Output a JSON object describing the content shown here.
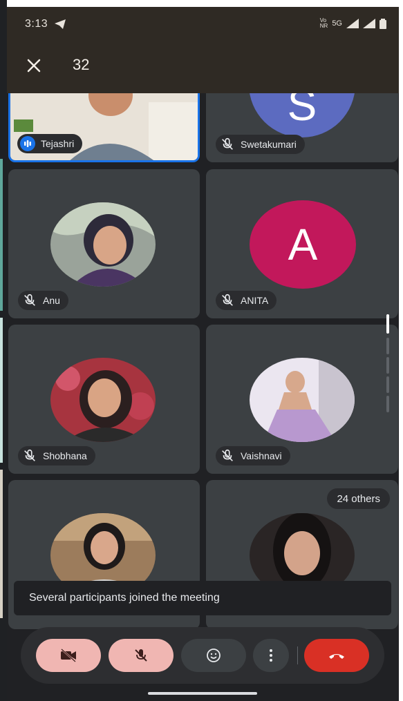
{
  "status_bar": {
    "time": "3:13",
    "network": "5G"
  },
  "header": {
    "participant_count": "32"
  },
  "participants": [
    {
      "name": "Tejashri",
      "speaking": true
    },
    {
      "name": "Swetakumari",
      "avatar_letter": "S",
      "avatar_color": "#5c6bc0"
    },
    {
      "name": "Anu"
    },
    {
      "name": "ANITA",
      "avatar_letter": "A",
      "avatar_color": "#c2185b"
    },
    {
      "name": "Shobhana"
    },
    {
      "name": "Vaishnavi"
    }
  ],
  "others_label": "24 others",
  "toast": "Several participants joined the meeting",
  "controls": {
    "camera": "camera-off",
    "mic": "mic-off",
    "reactions": "emoji",
    "more": "more-options",
    "end_call": "end-call"
  },
  "colors": {
    "active_border": "#1a73e8",
    "end_call": "#d93025",
    "muted_button": "#f0b6b2"
  }
}
